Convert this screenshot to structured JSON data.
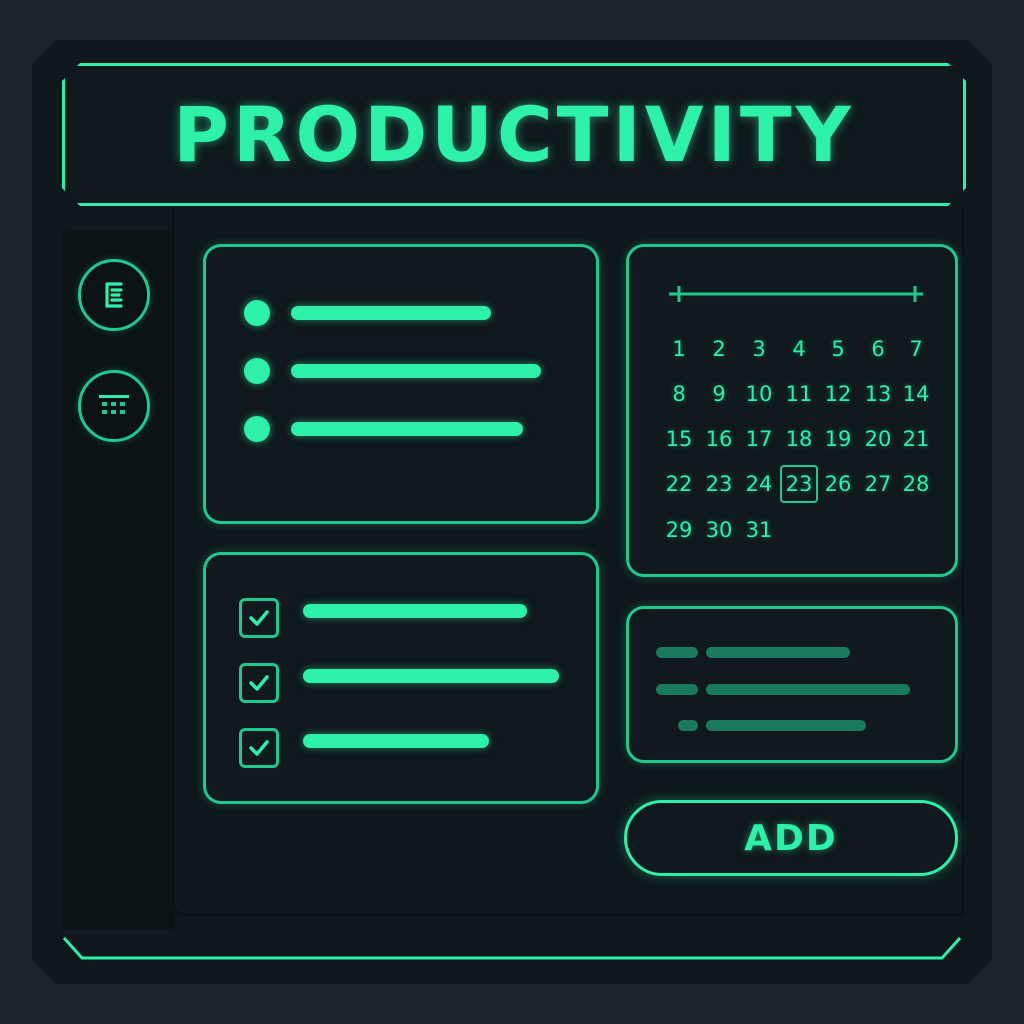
{
  "app": {
    "title": "PRODUCTIVITY"
  },
  "sidebar": {
    "items": [
      {
        "icon": "list-menu-icon"
      },
      {
        "icon": "calendar-icon"
      }
    ]
  },
  "calendar": {
    "days": [
      "1",
      "2",
      "3",
      "4",
      "5",
      "6",
      "7",
      "8",
      "9",
      "10",
      "11",
      "12",
      "13",
      "14",
      "15",
      "16",
      "17",
      "18",
      "19",
      "20",
      "21",
      "22",
      "23",
      "24",
      "23",
      "26",
      "27",
      "28",
      "29",
      "30",
      "31"
    ],
    "selected_index": 24
  },
  "actions": {
    "add_label": "ADD"
  },
  "colors": {
    "accent": "#2df0a9",
    "accent_dim": "#1a7a5e",
    "background": "#0f181c"
  }
}
